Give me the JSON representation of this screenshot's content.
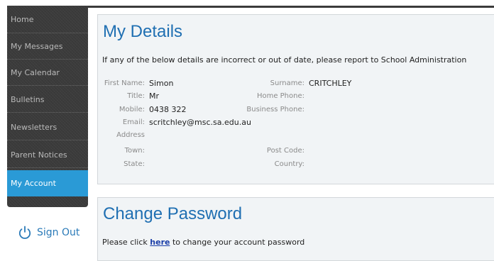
{
  "sidebar": {
    "items": [
      {
        "label": "Home"
      },
      {
        "label": "My Messages"
      },
      {
        "label": "My Calendar"
      },
      {
        "label": "Bulletins"
      },
      {
        "label": "Newsletters"
      },
      {
        "label": "Parent Notices"
      },
      {
        "label": "My Account"
      }
    ],
    "active_index": 6,
    "signout_label": "Sign Out",
    "signout_icon": "power-icon"
  },
  "details": {
    "title": "My Details",
    "intro": "If any of the below details are incorrect or out of date, please report to School Administration",
    "first_name_label": "First Name:",
    "first_name": "Simon",
    "title_label": "Title:",
    "title_value": "Mr",
    "mobile_label": "Mobile:",
    "mobile": "0438 322",
    "email_label": "Email:",
    "email": "scritchley@msc.sa.edu.au",
    "address_label": "Address",
    "town_label": "Town:",
    "state_label": "State:",
    "surname_label": "Surname:",
    "surname": "CRITCHLEY",
    "home_phone_label": "Home Phone:",
    "business_phone_label": "Business Phone:",
    "post_code_label": "Post Code:",
    "country_label": "Country:"
  },
  "password": {
    "title": "Change Password",
    "text_before": "Please click ",
    "link": "here",
    "text_after": " to change your account password"
  },
  "colors": {
    "accent": "#2a9ad6",
    "heading": "#1f6fb2",
    "sidebar_bg": "#3b3b3b",
    "panel_bg": "#f1f4f6"
  }
}
